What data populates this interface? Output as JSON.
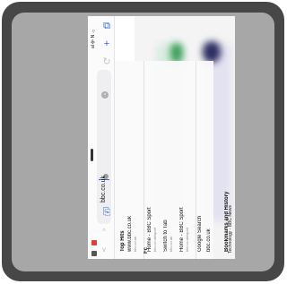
{
  "status_bar": {
    "text": "al 令 N ⌂"
  },
  "toolbar": {
    "tabs_icon": "tabs-icon",
    "new_tab_icon": "plus-icon",
    "reload_icon": "reload-icon",
    "share_icon": "share-icon"
  },
  "address": {
    "value": "bbc.co.uk"
  },
  "suggestions": {
    "header": "Top Hits",
    "top_hit": {
      "title": "www.bbc.co.uk",
      "subtitle": "bbc.co.uk"
    },
    "items": [
      {
        "title": "Home - BBC Sport",
        "subtitle": "bbc.co.uk/sport"
      },
      {
        "title": "Switch to Tab",
        "subtitle": "bbc.co.uk"
      },
      {
        "title": "Home - BBC Sport",
        "subtitle": "bbc.co.uk/sport"
      },
      {
        "title": "Google Search",
        "subtitle": ""
      },
      {
        "title": "bbc.co.uk",
        "subtitle": ""
      }
    ],
    "section": "Bookmarks and History",
    "tail": "Technology - BBC News"
  },
  "page_text": "Fc",
  "colors": {
    "frame": "#474747",
    "frame_inner": "#a7a7a7",
    "accent": "#2a6be0",
    "bbc_green": "#3fa05b"
  }
}
